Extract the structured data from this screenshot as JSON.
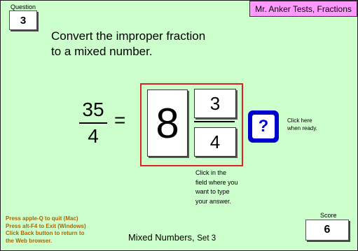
{
  "question": {
    "label": "Question",
    "number": "3"
  },
  "header": {
    "title": "Mr. Anker Tests, Fractions"
  },
  "instruction": {
    "line1": "Convert the improper fraction",
    "line2": "to a mixed number."
  },
  "problem": {
    "numerator": "35",
    "denominator": "4",
    "equals": "="
  },
  "answer": {
    "whole": "8",
    "numerator": "3",
    "denominator": "4"
  },
  "help": {
    "icon": "question-mark-icon",
    "symbol": "?",
    "hint_line1": "Click here",
    "hint_line2": "when ready."
  },
  "answer_hint": {
    "line1": "Click in the",
    "line2": "field where you",
    "line3": "want to type",
    "line4": "your answer."
  },
  "quit_instructions": {
    "line1": "Press apple-Q to quit (Mac)",
    "line2": "Press alt-F4 to Exit (Windows)",
    "line3": "Click Back button to return to",
    "line4": "the Web browser."
  },
  "footer": {
    "title": "Mixed Numbers,",
    "set": "Set 3"
  },
  "score": {
    "label": "Score",
    "value": "6"
  },
  "colors": {
    "background": "#ccffcc",
    "title_tab": "#ff99ff",
    "answer_border": "#dd2222",
    "help_button": "#0000cc",
    "quit_text": "#aa6600"
  }
}
